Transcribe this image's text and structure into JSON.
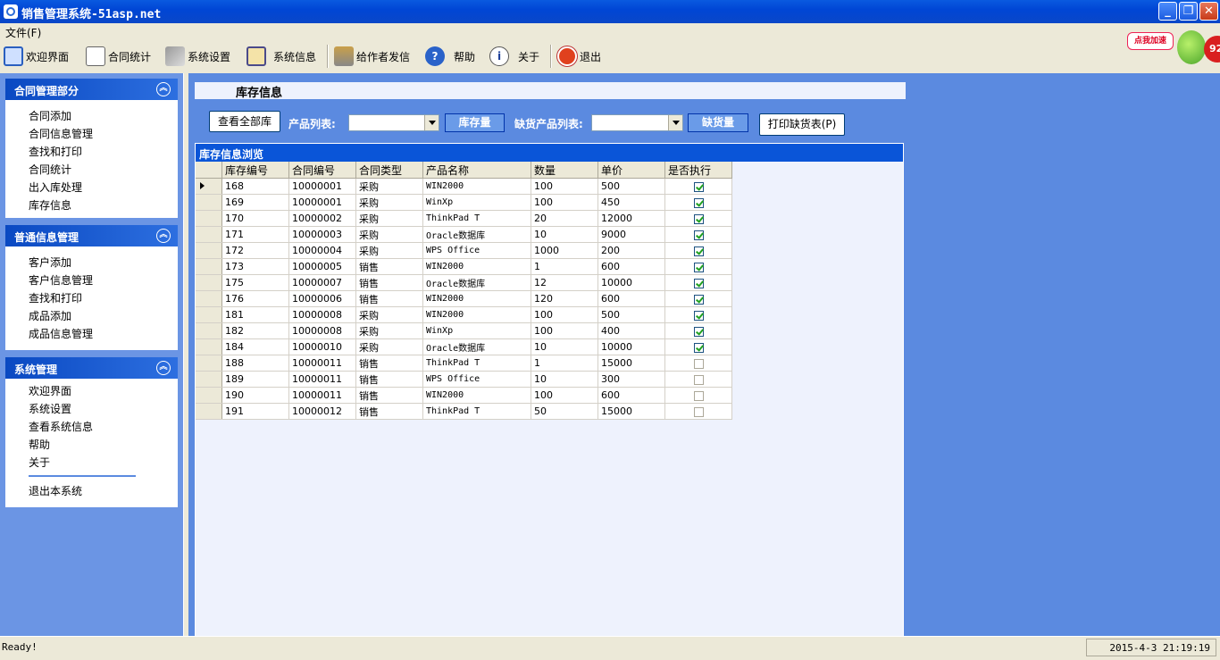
{
  "window": {
    "title": "销售管理系统-51asp.net",
    "buttons": {
      "minimize": "_",
      "maximize": "❐",
      "close": "✕"
    }
  },
  "menu": {
    "file": "文件(F)"
  },
  "toolbar": {
    "items": [
      {
        "label": "欢迎界面",
        "icon": "window-icon"
      },
      {
        "label": "合同统计",
        "icon": "document-pencil-icon"
      },
      {
        "label": "系统设置",
        "icon": "tools-icon"
      },
      {
        "label": "系统信息",
        "icon": "info-window-icon"
      },
      {
        "label": "给作者发信",
        "icon": "mail-pen-icon"
      },
      {
        "label": "帮助",
        "icon": "help-icon"
      },
      {
        "label": "关于",
        "icon": "info-icon"
      },
      {
        "label": "退出",
        "icon": "power-icon"
      }
    ]
  },
  "badge": {
    "text": "点我加速",
    "value": "92"
  },
  "sidebar": {
    "groups": [
      {
        "title": "合同管理部分",
        "items": [
          "合同添加",
          "合同信息管理",
          "查找和打印",
          "合同统计",
          "出入库处理",
          "库存信息"
        ]
      },
      {
        "title": "普通信息管理",
        "items": [
          "客户添加",
          "客户信息管理",
          "查找和打印",
          "成品添加",
          "成品信息管理"
        ]
      },
      {
        "title": "系统管理",
        "items": [
          "欢迎界面",
          "系统设置",
          "查看系统信息",
          "帮助",
          "关于"
        ],
        "footer": "退出本系统"
      }
    ]
  },
  "main": {
    "title": "库存信息",
    "view_all_button": "查看全部库",
    "product_list_label": "产品列表:",
    "product_list_value": "",
    "stock_button": "库存量",
    "shortage_list_label": "缺货产品列表:",
    "shortage_list_value": "",
    "shortage_button": "缺货量",
    "print_button": "打印缺货表(P)"
  },
  "grid": {
    "caption": "库存信息浏览",
    "columns": [
      "库存编号",
      "合同编号",
      "合同类型",
      "产品名称",
      "数量",
      "单价",
      "是否执行"
    ],
    "rows": [
      [
        "168",
        "10000001",
        "采购",
        "WIN2000",
        "100",
        "500",
        true
      ],
      [
        "169",
        "10000001",
        "采购",
        "WinXp",
        "100",
        "450",
        true
      ],
      [
        "170",
        "10000002",
        "采购",
        "ThinkPad T",
        "20",
        "12000",
        true
      ],
      [
        "171",
        "10000003",
        "采购",
        "Oracle数据库",
        "10",
        "9000",
        true
      ],
      [
        "172",
        "10000004",
        "采购",
        "WPS Office",
        "1000",
        "200",
        true
      ],
      [
        "173",
        "10000005",
        "销售",
        "WIN2000",
        "1",
        "600",
        true
      ],
      [
        "175",
        "10000007",
        "销售",
        "Oracle数据库",
        "12",
        "10000",
        true
      ],
      [
        "176",
        "10000006",
        "销售",
        "WIN2000",
        "120",
        "600",
        true
      ],
      [
        "181",
        "10000008",
        "采购",
        "WIN2000",
        "100",
        "500",
        true
      ],
      [
        "182",
        "10000008",
        "采购",
        "WinXp",
        "100",
        "400",
        true
      ],
      [
        "184",
        "10000010",
        "采购",
        "Oracle数据库",
        "10",
        "10000",
        true
      ],
      [
        "188",
        "10000011",
        "销售",
        "ThinkPad T",
        "1",
        "15000",
        false
      ],
      [
        "189",
        "10000011",
        "销售",
        "WPS Office",
        "10",
        "300",
        false
      ],
      [
        "190",
        "10000011",
        "销售",
        "WIN2000",
        "100",
        "600",
        false
      ],
      [
        "191",
        "10000012",
        "销售",
        "ThinkPad T",
        "50",
        "15000",
        false
      ]
    ]
  },
  "status": {
    "left": "Ready!",
    "right": "2015-4-3 21:19:19"
  }
}
